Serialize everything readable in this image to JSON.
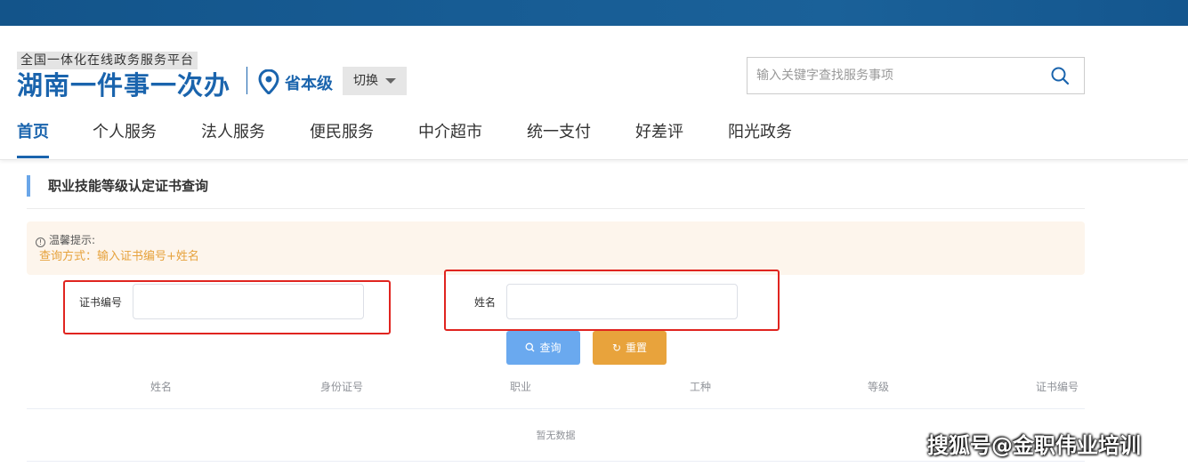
{
  "header": {
    "platform_subtitle": "全国一体化在线政务服务平台",
    "brand_title": "湖南一件事一次办",
    "region_level": "省本级",
    "switch_label": "切换",
    "search_placeholder": "输入关键字查找服务事项"
  },
  "nav": {
    "items": [
      {
        "label": "首页",
        "active": true
      },
      {
        "label": "个人服务"
      },
      {
        "label": "法人服务"
      },
      {
        "label": "便民服务"
      },
      {
        "label": "中介超市"
      },
      {
        "label": "统一支付"
      },
      {
        "label": "好差评"
      },
      {
        "label": "阳光政务"
      }
    ]
  },
  "page": {
    "section_title": "职业技能等级认定证书查询",
    "tip_heading": "温馨提示:",
    "tip_text": "查询方式：输入证书编号+姓名"
  },
  "form": {
    "cert_label": "证书编号",
    "cert_value": "",
    "name_label": "姓名",
    "name_value": "",
    "query_button": "查询",
    "reset_button": "重置"
  },
  "table": {
    "columns": [
      "姓名",
      "身份证号",
      "职业",
      "工种",
      "等级",
      "证书编号"
    ],
    "empty_text": "暂无数据"
  },
  "watermark": "搜狐号@金职伟业培训",
  "colors": {
    "brand_blue": "#1a64ad",
    "top_band": "#175c94",
    "tip_bg": "#fdf5ec",
    "tip_text": "#e6a23c",
    "query_button": "#6aa9ef",
    "reset_button": "#e8a33c",
    "highlight_red": "#e0241f"
  }
}
